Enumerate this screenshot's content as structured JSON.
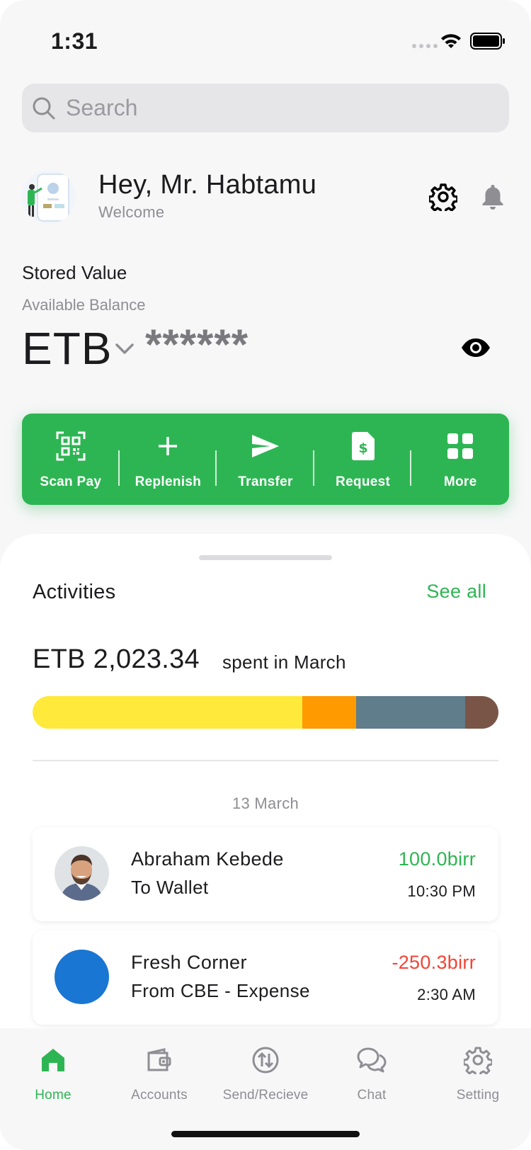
{
  "status": {
    "time": "1:31"
  },
  "search": {
    "placeholder": "Search"
  },
  "profile": {
    "greeting": "Hey, Mr. Habtamu",
    "welcome": "Welcome"
  },
  "balance": {
    "title": "Stored Value",
    "label": "Available Balance",
    "currency": "ETB",
    "masked_value": "******"
  },
  "actions": [
    {
      "label": "Scan Pay",
      "icon": "qr-scan-icon"
    },
    {
      "label": "Replenish",
      "icon": "plus-icon"
    },
    {
      "label": "Transfer",
      "icon": "send-icon"
    },
    {
      "label": "Request",
      "icon": "dollar-document-icon"
    },
    {
      "label": "More",
      "icon": "grid-icon"
    }
  ],
  "activities": {
    "title": "Activities",
    "see_all": "See all",
    "spent_amount": "ETB 2,023.34",
    "spent_label": "spent in March",
    "spend_segments": [
      {
        "fraction": 0.579,
        "color": "#ffe93a"
      },
      {
        "fraction": 0.116,
        "color": "#ff9a00"
      },
      {
        "fraction": 0.234,
        "color": "#607d8b"
      },
      {
        "fraction": 0.071,
        "color": "#795548"
      }
    ],
    "date": "13 March",
    "transactions": [
      {
        "name": "Abraham Kebede",
        "sub": "To Wallet",
        "amount": "100.0birr",
        "time": "10:30 PM",
        "amount_color": "#2eb553"
      },
      {
        "name": "Fresh Corner",
        "sub": "From CBE - Expense",
        "amount": "-250.3birr",
        "time": "2:30 AM",
        "amount_color": "#f44336"
      }
    ]
  },
  "tabs": [
    {
      "label": "Home",
      "icon": "home-icon",
      "active": true
    },
    {
      "label": "Accounts",
      "icon": "wallet-icon"
    },
    {
      "label": "Send/Recieve",
      "icon": "swap-icon"
    },
    {
      "label": "Chat",
      "icon": "chat-icon"
    },
    {
      "label": "Setting",
      "icon": "gear-icon"
    }
  ],
  "colors": {
    "accent": "#2eb553",
    "negative": "#f44336",
    "muted": "#8e8e93"
  }
}
